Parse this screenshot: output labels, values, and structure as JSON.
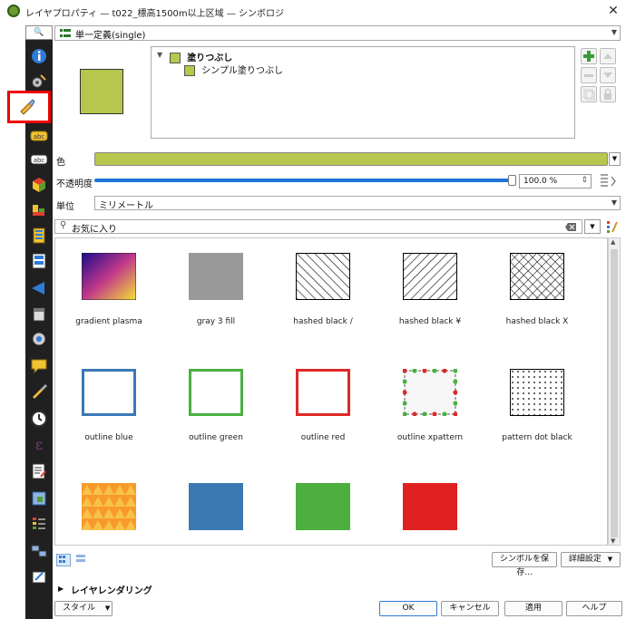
{
  "window": {
    "title": "レイヤプロパティ — t022_標高1500m以上区域 — シンボロジ",
    "close_glyph": "✕"
  },
  "sidebar": {
    "search_glyph": "🔍"
  },
  "renderer": {
    "value": "単一定義(single)"
  },
  "tree": {
    "root_label": "塗りつぶし",
    "child_label": "シンプル塗りつぶし"
  },
  "color": {
    "label": "色",
    "swatch": "#b7c64c"
  },
  "opacity": {
    "label": "不透明度",
    "value": "100.0 %"
  },
  "unit": {
    "label": "単位",
    "value": "ミリメートル"
  },
  "favorites": {
    "placeholder": "お気に入り"
  },
  "symbols": [
    {
      "label": "gradient  plasma"
    },
    {
      "label": "gray 3 fill"
    },
    {
      "label": "hashed black /"
    },
    {
      "label": "hashed black ¥"
    },
    {
      "label": "hashed black X"
    },
    {
      "label": "outline blue"
    },
    {
      "label": "outline green"
    },
    {
      "label": "outline red"
    },
    {
      "label": "outline xpattern"
    },
    {
      "label": "pattern dot black"
    },
    {
      "label": ""
    },
    {
      "label": ""
    },
    {
      "label": ""
    },
    {
      "label": ""
    }
  ],
  "buttons": {
    "save_symbol": "シンボルを保存...",
    "advanced": "詳細設定",
    "layer_rendering": "レイヤレンダリング",
    "style": "スタイル",
    "ok": "OK",
    "cancel": "キャンセル",
    "apply": "適用",
    "help": "ヘルプ"
  }
}
